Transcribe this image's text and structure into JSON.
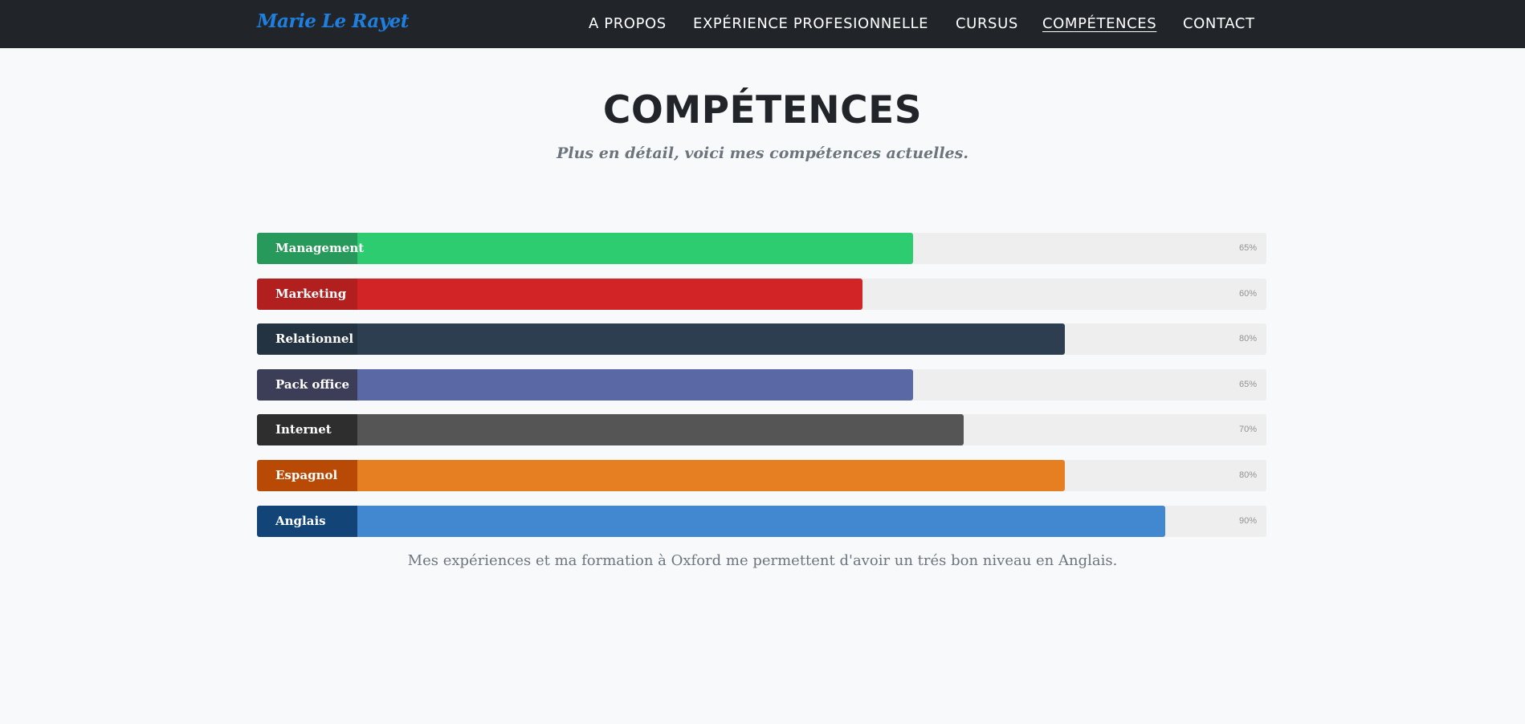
{
  "nav": {
    "brand": "Marie Le Rayet",
    "links": [
      {
        "label": "A PROPOS",
        "active": false
      },
      {
        "label": "EXPÉRIENCE PROFESIONNELLE",
        "active": false
      },
      {
        "label": "CURSUS",
        "active": false
      },
      {
        "label": "COMPÉTENCES",
        "active": true
      },
      {
        "label": "CONTACT",
        "active": false
      }
    ]
  },
  "section": {
    "heading": "COMPÉTENCES",
    "subheading": "Plus en détail, voici mes compétences actuelles."
  },
  "skills": [
    {
      "label": "Management",
      "percent": 65,
      "percent_text": "65%",
      "bar_color": "#2ecc71",
      "label_color": "#27995a"
    },
    {
      "label": "Marketing",
      "percent": 60,
      "percent_text": "60%",
      "bar_color": "#d22326",
      "label_color": "#b21f1f"
    },
    {
      "label": "Relationnel",
      "percent": 80,
      "percent_text": "80%",
      "bar_color": "#2c3e50",
      "label_color": "#243342"
    },
    {
      "label": "Pack office",
      "percent": 65,
      "percent_text": "65%",
      "bar_color": "#5a69a6",
      "label_color": "#3c3e58"
    },
    {
      "label": "Internet",
      "percent": 70,
      "percent_text": "70%",
      "bar_color": "#555555",
      "label_color": "#2e2e2e"
    },
    {
      "label": "Espagnol",
      "percent": 80,
      "percent_text": "80%",
      "bar_color": "#e67e22",
      "label_color": "#b94a05"
    },
    {
      "label": "Anglais",
      "percent": 90,
      "percent_text": "90%",
      "bar_color": "#4288d0",
      "label_color": "#124478"
    }
  ],
  "note": "Mes expériences et ma formation à Oxford me permettent d'avoir un trés bon niveau en Anglais."
}
